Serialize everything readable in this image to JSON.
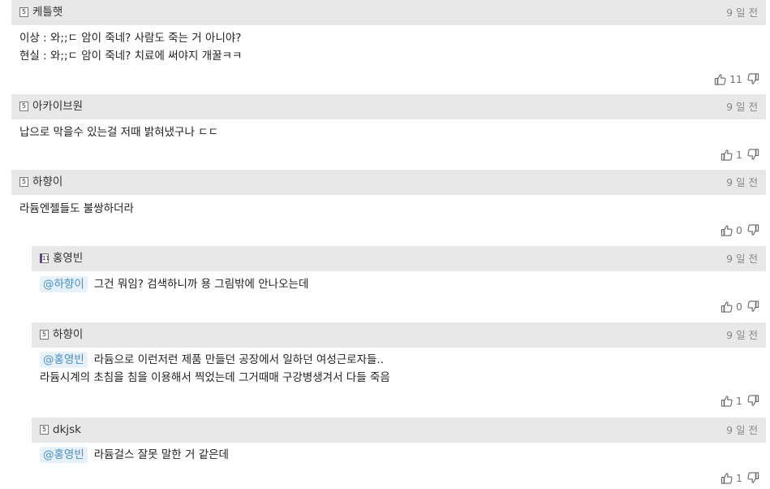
{
  "comments": [
    {
      "username": "케틀햇",
      "badge": "5",
      "time": "9 일 전",
      "lines": [
        "이상 : 와;;ㄷ 암이 죽네? 사람도 죽는 거 아니야?",
        "현실 : 와;;ㄷ 암이 죽네? 치료에 써야지 개꿀ㅋㅋ"
      ],
      "likes": "11"
    },
    {
      "username": "아카이브원",
      "badge": "5",
      "time": "9 일 전",
      "lines": [
        "납으로 막을수 있는걸 저때 밝혀냈구나 ㄷㄷ"
      ],
      "likes": "1"
    },
    {
      "username": "하향이",
      "badge": "5",
      "time": "9 일 전",
      "lines": [
        "라듐엔젤들도 불쌍하더라"
      ],
      "likes": "0"
    },
    {
      "username": "홍영빈",
      "badge": "11",
      "time": "9 일 전",
      "mention": "@하향이",
      "lines": [
        "그건 뭐임? 검색하니까 용 그림밖에 안나오는데"
      ],
      "likes": "0"
    },
    {
      "username": "하향이",
      "badge": "5",
      "time": "9 일 전",
      "mention": "@홍영빈",
      "lines": [
        "라듐으로 이런저런 제품 만들던 공장에서 일하던 여성근로자들..",
        "라듐시계의 초침을 침을 이용해서 찍었는데 그거때매 구강병생겨서 다들 죽음"
      ],
      "likes": "1"
    },
    {
      "username": "dkjsk",
      "badge": "5",
      "time": "9 일 전",
      "mention": "@홍영빈",
      "lines": [
        "라듐걸스 잘못 말한 거 같은데"
      ],
      "likes": "1"
    }
  ]
}
